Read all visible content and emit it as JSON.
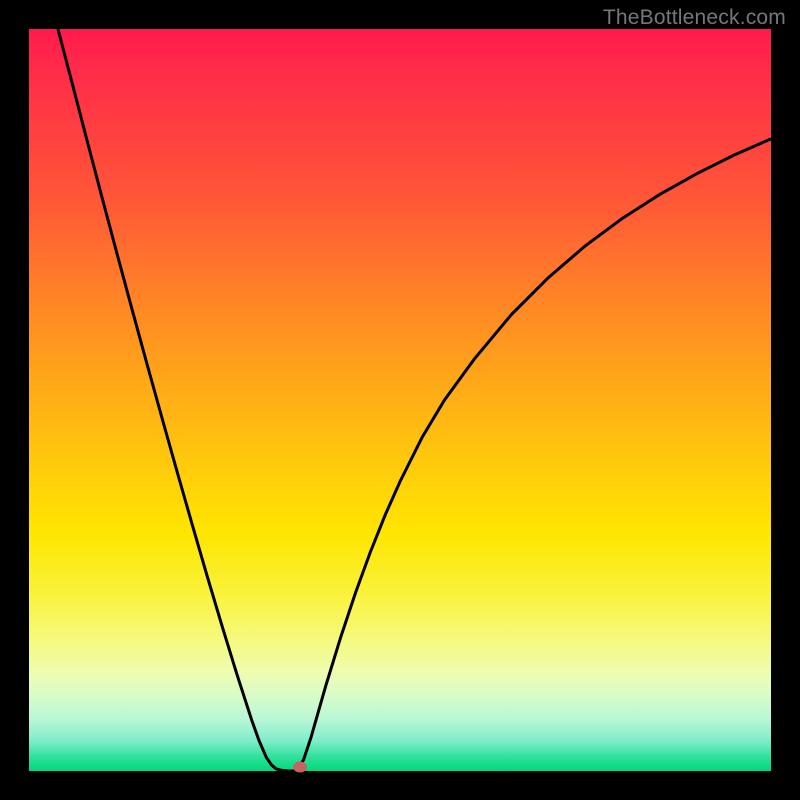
{
  "watermark": "TheBottleneck.com",
  "chart_data": {
    "type": "line",
    "title": "",
    "xlabel": "",
    "ylabel": "",
    "xlim": [
      0,
      100
    ],
    "ylim": [
      0,
      100
    ],
    "background": "rainbow-gradient",
    "series": [
      {
        "name": "curve-left",
        "x": [
          3.9,
          6,
          8,
          10,
          12,
          14,
          16,
          18,
          20,
          22,
          24,
          26,
          28,
          30,
          31,
          32,
          32.7,
          33.3,
          34,
          35,
          36
        ],
        "values": [
          100,
          92,
          84.3,
          76.7,
          69.2,
          61.8,
          54.5,
          47.3,
          40.2,
          33.2,
          26.3,
          19.6,
          13.1,
          6.9,
          4.1,
          1.8,
          0.8,
          0.3,
          0.1,
          0,
          0
        ]
      },
      {
        "name": "curve-right",
        "x": [
          36,
          37,
          38,
          39,
          40,
          42,
          44,
          46,
          48,
          50,
          53,
          56,
          60,
          65,
          70,
          75,
          80,
          85,
          90,
          95,
          100
        ],
        "values": [
          0,
          1.5,
          4.5,
          8,
          11.5,
          18,
          24,
          29.5,
          34.5,
          39,
          45,
          50,
          55.5,
          61.5,
          66.5,
          70.8,
          74.5,
          77.7,
          80.5,
          83,
          85.2
        ]
      }
    ],
    "marker": {
      "x": 36.5,
      "y": 0.5,
      "color": "#c7635f"
    }
  }
}
